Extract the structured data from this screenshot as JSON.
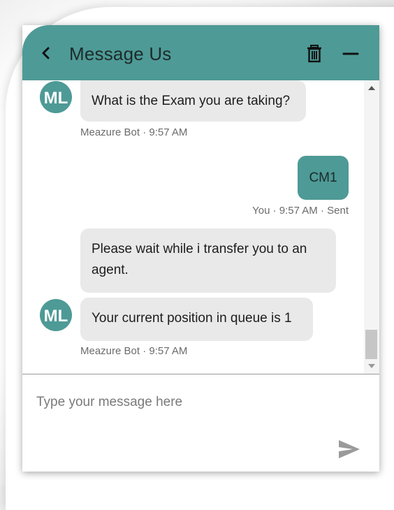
{
  "header": {
    "title": "Message Us",
    "back_icon": "chevron-left-icon",
    "delete_icon": "trash-icon",
    "minimize_icon": "minimize-icon",
    "background_color": "#4e9a96"
  },
  "messages": [
    {
      "sender": "bot",
      "avatar_text": "ML",
      "text": "What is the Exam you are taking?",
      "meta": "Meazure Bot · 9:57 AM"
    },
    {
      "sender": "user",
      "text": "CM1",
      "meta": "You · 9:57 AM · Sent"
    },
    {
      "sender": "bot",
      "text": "Please wait while i transfer you to an agent."
    },
    {
      "sender": "bot",
      "avatar_text": "ML",
      "text": "Your current position in queue is 1",
      "meta": "Meazure Bot · 9:57 AM"
    }
  ],
  "composer": {
    "placeholder": "Type your message here",
    "value": "",
    "send_icon": "send-icon"
  },
  "colors": {
    "accent": "#4e9a96",
    "bot_bubble": "#e9e9e9",
    "meta_text": "#6b6b6b"
  }
}
